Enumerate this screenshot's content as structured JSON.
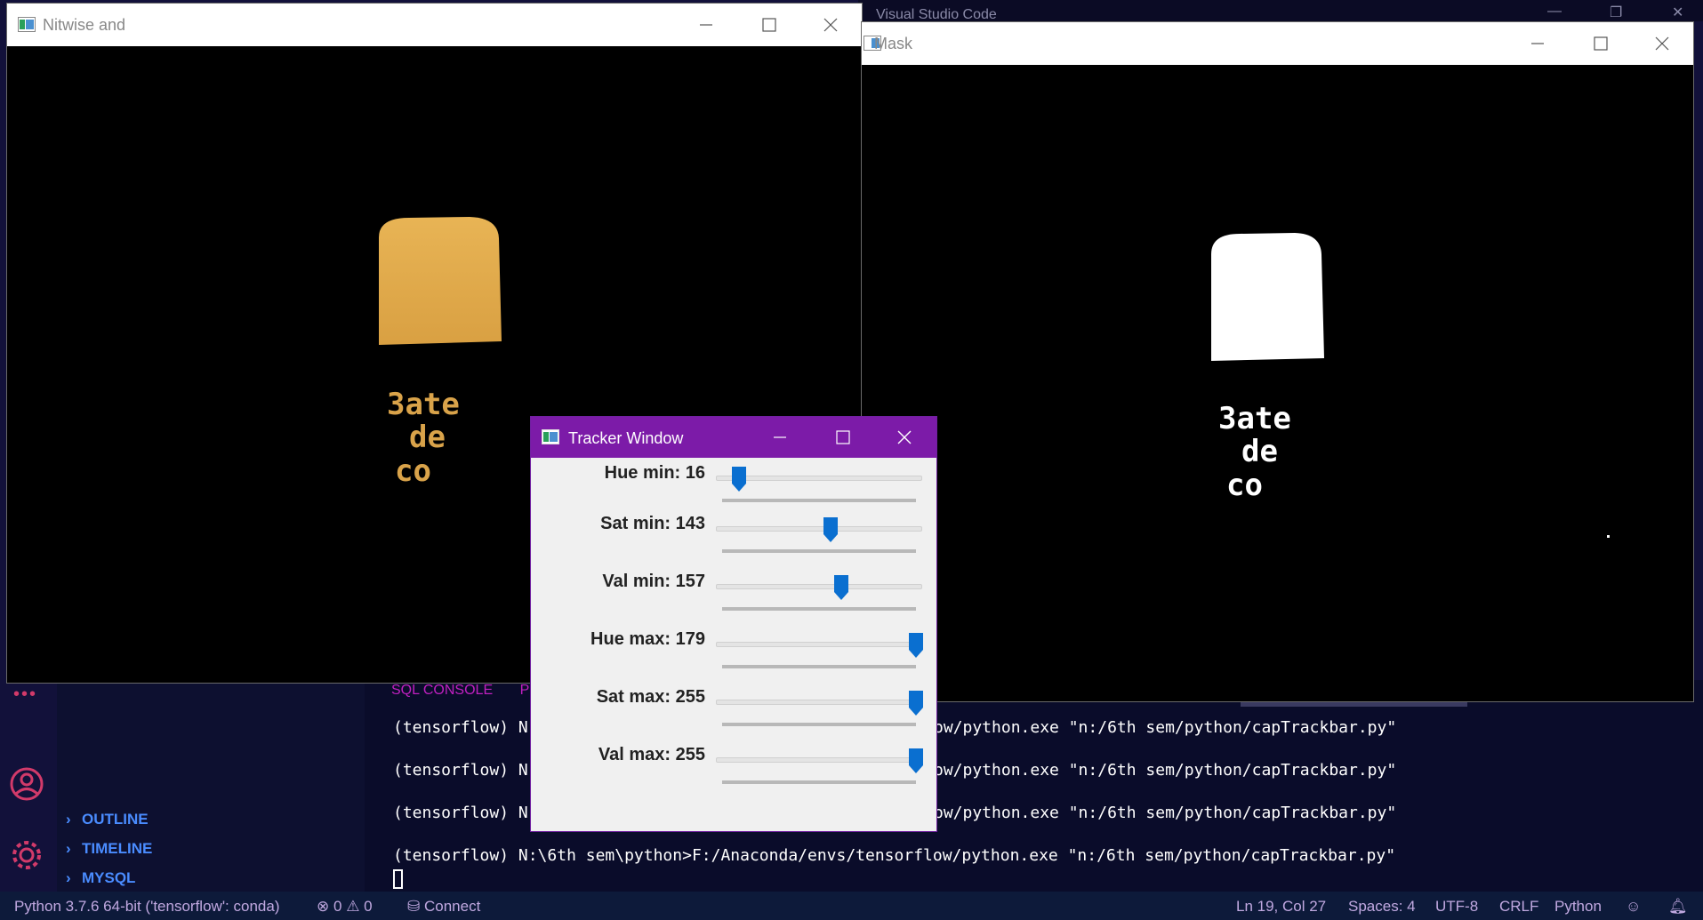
{
  "vscode": {
    "title": "Visual Studio Code",
    "sidebar_sections": [
      {
        "label": "OUTLINE"
      },
      {
        "label": "TIMELINE"
      },
      {
        "label": "MYSQL"
      }
    ],
    "panel_tabs": [
      "SQL CONSOLE",
      "PR"
    ],
    "terminal_lines": [
      {
        "prefix": "(tensorflow) N",
        "suffix": "ow/python.exe \"n:/6th sem/python/capTrackbar.py\""
      },
      {
        "prefix": "(tensorflow) N",
        "suffix": "ow/python.exe \"n:/6th sem/python/capTrackbar.py\""
      },
      {
        "prefix": "(tensorflow) N",
        "suffix": "ow/python.exe \"n:/6th sem/python/capTrackbar.py\""
      }
    ],
    "terminal_last": "(tensorflow) N:\\6th sem\\python>F:/Anaconda/envs/tensorflow/python.exe \"n:/6th sem/python/capTrackbar.py\"",
    "status": {
      "interpreter": "Python 3.7.6 64-bit ('tensorflow': conda)",
      "errors": "0",
      "warnings": "0",
      "connect": "Connect",
      "position": "Ln 19, Col 27",
      "spaces": "Spaces: 4",
      "encoding": "UTF-8",
      "eol": "CRLF",
      "language": "Python"
    }
  },
  "windows": {
    "bitwise": {
      "title": "Nitwise and",
      "label_text": [
        "3ate",
        "de",
        "co"
      ]
    },
    "mask": {
      "title": "Mask",
      "label_text": [
        "3ate",
        "de",
        "co"
      ]
    },
    "tracker": {
      "title": "Tracker Window",
      "trackbars": [
        {
          "label": "Hue min: 16",
          "value": 16,
          "max": 179
        },
        {
          "label": "Sat min: 143",
          "value": 143,
          "max": 255
        },
        {
          "label": "Val min: 157",
          "value": 157,
          "max": 255
        },
        {
          "label": "Hue max: 179",
          "value": 179,
          "max": 179
        },
        {
          "label": "Sat max: 255",
          "value": 255,
          "max": 255
        },
        {
          "label": "Val max: 255",
          "value": 255,
          "max": 255
        }
      ]
    }
  },
  "colors": {
    "tracker_titlebar": "#7c1ba8",
    "slider_thumb": "#0a6fd0",
    "object_color": "#e0a94a"
  }
}
